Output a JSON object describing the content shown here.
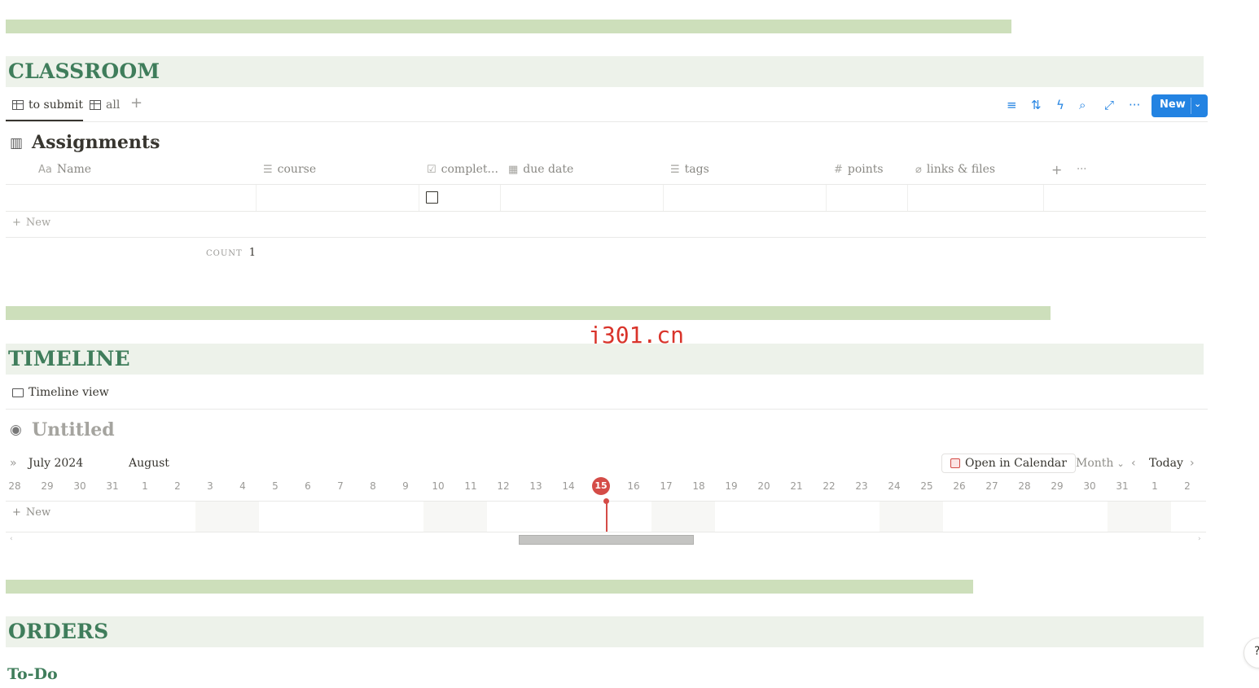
{
  "classroom": {
    "title": "CLASSROOM",
    "tabs": [
      {
        "label": "to submit",
        "active": true
      },
      {
        "label": "all",
        "active": false
      }
    ],
    "add_view": "+",
    "toolbar": {
      "new_label": "New"
    },
    "database": {
      "title": "Assignments",
      "more": "···",
      "columns": [
        {
          "icon": "Aa",
          "label": "Name"
        },
        {
          "icon": "☰",
          "label": "course"
        },
        {
          "icon": "☑",
          "label": "complet..."
        },
        {
          "icon": "▦",
          "label": "due date"
        },
        {
          "icon": "☰",
          "label": "tags"
        },
        {
          "icon": "#",
          "label": "points"
        },
        {
          "icon": "⌀",
          "label": "links & files"
        }
      ],
      "row_completed": false,
      "new_row": "New",
      "count_label": "COUNT",
      "count_value": "1"
    }
  },
  "watermark": "j301.cn",
  "timeline": {
    "title": "TIMELINE",
    "view_tab": "Timeline view",
    "db_title": "Untitled",
    "month_label": "July 2024",
    "next_month_label": "August",
    "open_calendar": "Open in Calendar",
    "scale": "Month",
    "today": "Today",
    "days": [
      "28",
      "29",
      "30",
      "31",
      "1",
      "2",
      "3",
      "4",
      "5",
      "6",
      "7",
      "8",
      "9",
      "10",
      "11",
      "12",
      "13",
      "14",
      "15",
      "16",
      "17",
      "18",
      "19",
      "20",
      "21",
      "22",
      "23",
      "24",
      "25",
      "26",
      "27",
      "28",
      "29",
      "30",
      "31",
      "1",
      "2"
    ],
    "today_day": "15",
    "new_row": "New"
  },
  "orders": {
    "title": "ORDERS",
    "subtitle": "To-Do"
  },
  "colors": {
    "accent_blue": "#2383e2",
    "section_green": "#3f7d5b",
    "divider_green": "#cddfbb",
    "today_red": "#d44c47"
  }
}
